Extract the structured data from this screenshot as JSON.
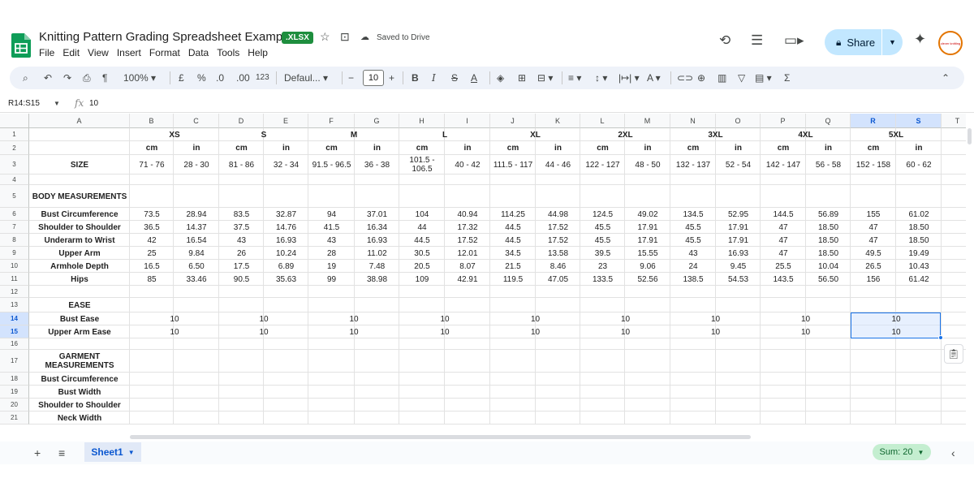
{
  "title": {
    "doc_name": "Knitting Pattern Grading Spreadsheet Example",
    "badge": ".XLSX",
    "saved": "Saved to Drive",
    "menus": [
      "File",
      "Edit",
      "View",
      "Insert",
      "Format",
      "Data",
      "Tools",
      "Help"
    ],
    "share_label": "Share",
    "avatar_text": "clever\nknitting"
  },
  "toolbar": {
    "zoom": "100%",
    "currency": "£",
    "percent": "%",
    "dec_dec": ".0",
    "dec_inc": ".00",
    "number_format": "123",
    "font": "Defaul...",
    "font_size": "10",
    "bold": "B",
    "italic": "I",
    "strike": "S",
    "text_color": "A",
    "sigma": "Σ"
  },
  "formula_bar": {
    "name_box": "R14:S15",
    "fx": "fx",
    "value": "10"
  },
  "columns": [
    "A",
    "B",
    "C",
    "D",
    "E",
    "F",
    "G",
    "H",
    "I",
    "J",
    "K",
    "L",
    "M",
    "N",
    "O",
    "P",
    "Q",
    "R",
    "S",
    "T"
  ],
  "rows": [
    "1",
    "2",
    "3",
    "4",
    "5",
    "6",
    "7",
    "8",
    "9",
    "10",
    "11",
    "12",
    "13",
    "14",
    "15",
    "16",
    "17",
    "18",
    "19",
    "20",
    "21"
  ],
  "sizes": [
    "XS",
    "S",
    "M",
    "L",
    "XL",
    "2XL",
    "3XL",
    "4XL",
    "5XL"
  ],
  "units": [
    "cm",
    "in"
  ],
  "size_label": "SIZE",
  "size_ranges": [
    "71 - 76",
    "28 - 30",
    "81 - 86",
    "32 - 34",
    "91.5 - 96.5",
    "36 - 38",
    "101.5 - 106.5",
    "40 - 42",
    "111.5 - 117",
    "44 - 46",
    "122 - 127",
    "48 - 50",
    "132 - 137",
    "52 - 54",
    "142 - 147",
    "56 - 58",
    "152 - 158",
    "60 - 62"
  ],
  "body_heading": "BODY MEASUREMENTS",
  "body_rows": [
    {
      "label": "Bust Circumference",
      "values": [
        "73.5",
        "28.94",
        "83.5",
        "32.87",
        "94",
        "37.01",
        "104",
        "40.94",
        "114.25",
        "44.98",
        "124.5",
        "49.02",
        "134.5",
        "52.95",
        "144.5",
        "56.89",
        "155",
        "61.02"
      ]
    },
    {
      "label": "Shoulder to Shoulder",
      "values": [
        "36.5",
        "14.37",
        "37.5",
        "14.76",
        "41.5",
        "16.34",
        "44",
        "17.32",
        "44.5",
        "17.52",
        "45.5",
        "17.91",
        "45.5",
        "17.91",
        "47",
        "18.50",
        "47",
        "18.50"
      ]
    },
    {
      "label": "Underarm to Wrist",
      "values": [
        "42",
        "16.54",
        "43",
        "16.93",
        "43",
        "16.93",
        "44.5",
        "17.52",
        "44.5",
        "17.52",
        "45.5",
        "17.91",
        "45.5",
        "17.91",
        "47",
        "18.50",
        "47",
        "18.50"
      ]
    },
    {
      "label": "Upper Arm",
      "values": [
        "25",
        "9.84",
        "26",
        "10.24",
        "28",
        "11.02",
        "30.5",
        "12.01",
        "34.5",
        "13.58",
        "39.5",
        "15.55",
        "43",
        "16.93",
        "47",
        "18.50",
        "49.5",
        "19.49"
      ]
    },
    {
      "label": "Armhole Depth",
      "values": [
        "16.5",
        "6.50",
        "17.5",
        "6.89",
        "19",
        "7.48",
        "20.5",
        "8.07",
        "21.5",
        "8.46",
        "23",
        "9.06",
        "24",
        "9.45",
        "25.5",
        "10.04",
        "26.5",
        "10.43"
      ]
    },
    {
      "label": "Hips",
      "values": [
        "85",
        "33.46",
        "90.5",
        "35.63",
        "99",
        "38.98",
        "109",
        "42.91",
        "119.5",
        "47.05",
        "133.5",
        "52.56",
        "138.5",
        "54.53",
        "143.5",
        "56.50",
        "156",
        "61.42"
      ]
    }
  ],
  "ease_heading": "EASE",
  "ease_rows": [
    {
      "label": "Bust Ease",
      "values": [
        "10",
        "10",
        "10",
        "10",
        "10",
        "10",
        "10",
        "10",
        "10"
      ]
    },
    {
      "label": "Upper Arm Ease",
      "values": [
        "10",
        "10",
        "10",
        "10",
        "10",
        "10",
        "10",
        "10",
        "10"
      ]
    }
  ],
  "garment_heading": "GARMENT MEASUREMENTS",
  "garment_rows": [
    "Bust Circumference",
    "Bust Width",
    "Shoulder to Shoulder",
    "Neck Width"
  ],
  "bottom": {
    "sheet_name": "Sheet1",
    "sum": "Sum: 20"
  }
}
